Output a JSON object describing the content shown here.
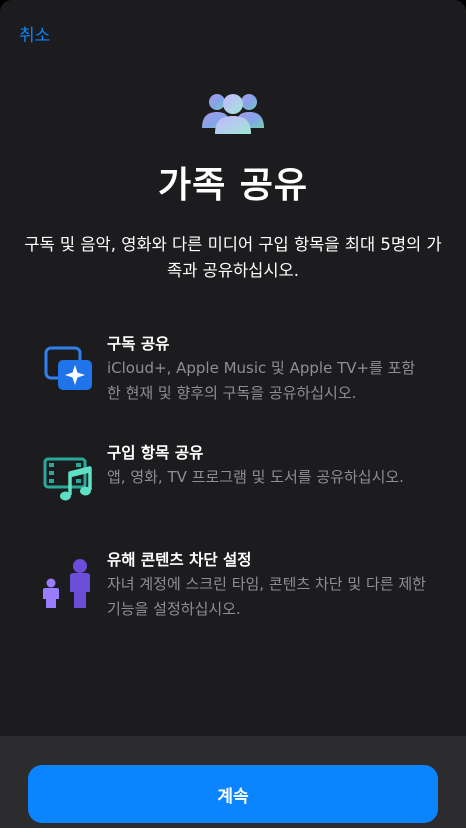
{
  "nav": {
    "cancel_label": "취소"
  },
  "header": {
    "icon": "family-people-icon",
    "title": "가족 공유",
    "subtitle": "구독 및 음악, 영화와 다른 미디어 구입 항목을 최대 5명의 가족과 공유하십시오."
  },
  "features": [
    {
      "icon": "subscription-share-icon",
      "title": "구독 공유",
      "description": "iCloud+, Apple Music 및 Apple TV+를 포함한 현재 및 향후의 구독을 공유하십시오."
    },
    {
      "icon": "purchase-share-icon",
      "title": "구입 항목 공유",
      "description": "앱, 영화, TV 프로그램 및 도서를 공유하십시오."
    },
    {
      "icon": "parental-controls-icon",
      "title": "유해 콘텐츠 차단 설정",
      "description": "자녀 계정에 스크린 타임, 콘텐츠 차단 및 다른 제한 기능을 설정하십시오."
    }
  ],
  "footer": {
    "continue_label": "계속"
  },
  "colors": {
    "accent": "#0a84ff",
    "sheet_background": "#1c1c1e",
    "secondary_text": "#8e8e93"
  }
}
